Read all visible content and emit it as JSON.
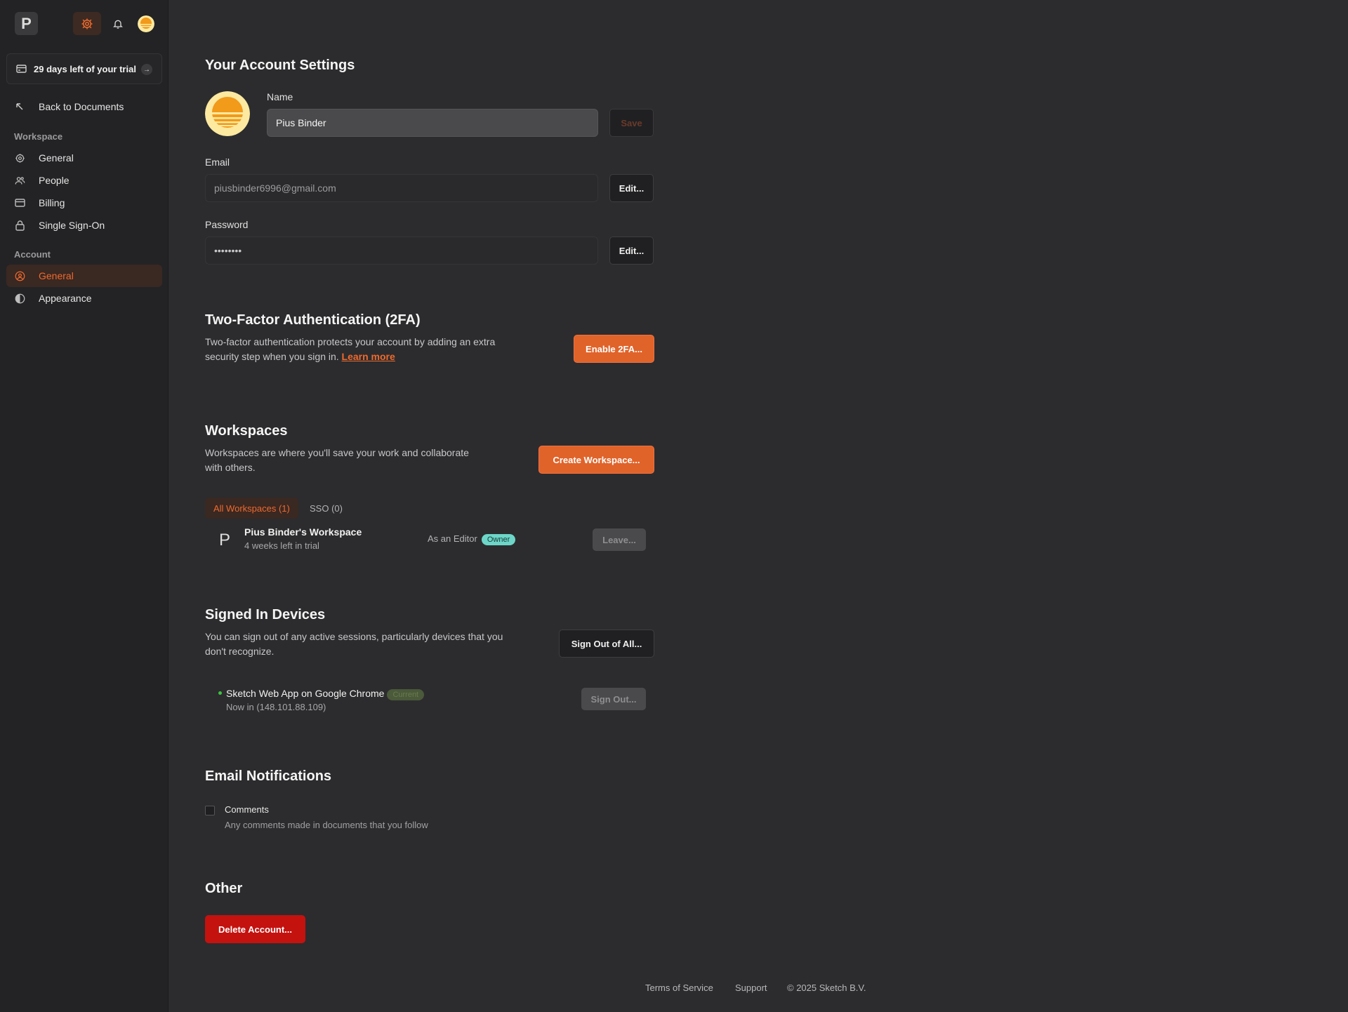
{
  "topbar": {
    "workspace_initial": "P",
    "icons": [
      "gear-icon",
      "bell-icon",
      "user-avatar"
    ],
    "accent": "#ee6a2e"
  },
  "trial": {
    "label": "29 days left of your trial"
  },
  "sidebar": {
    "back": "Back to Documents",
    "workspace_heading": "Workspace",
    "workspace_items": [
      {
        "label": "General",
        "icon": "gear-icon"
      },
      {
        "label": "People",
        "icon": "people-icon"
      },
      {
        "label": "Billing",
        "icon": "credit-card-icon"
      },
      {
        "label": "Single Sign-On",
        "icon": "lock-icon"
      }
    ],
    "account_heading": "Account",
    "account_items": [
      {
        "label": "General",
        "icon": "user-circle-icon",
        "selected": true
      },
      {
        "label": "Appearance",
        "icon": "contrast-icon"
      }
    ]
  },
  "account": {
    "title": "Your Account Settings",
    "name_label": "Name",
    "name_value": "Pius Binder",
    "save_label": "Save",
    "email_label": "Email",
    "email_value": "piusbinder6996@gmail.com",
    "email_edit": "Edit...",
    "password_label": "Password",
    "password_value": "••••••••",
    "password_edit": "Edit..."
  },
  "twofa": {
    "title": "Two-Factor Authentication (2FA)",
    "desc_line1": "Two-factor authentication protects your account by adding an extra",
    "desc_line2": "security step when you sign in.",
    "learn_more": "Learn more",
    "button": "Enable 2FA..."
  },
  "workspaces": {
    "title": "Workspaces",
    "desc_line1": "Workspaces are where you'll save your work and collaborate",
    "desc_line2": "with others.",
    "button": "Create Workspace...",
    "tabs": [
      {
        "label": "All Workspaces (1)",
        "active": true
      },
      {
        "label": "SSO (0)",
        "active": false
      }
    ],
    "items": [
      {
        "initial": "P",
        "name": "Pius Binder's Workspace",
        "sub": "4 weeks left in trial",
        "role": "As an Editor",
        "badge": "Owner",
        "action": "Leave..."
      }
    ]
  },
  "devices": {
    "title": "Signed In Devices",
    "desc_line1": "You can sign out of any active sessions, particularly devices that you",
    "desc_line2": "don't recognize.",
    "button": "Sign Out of All...",
    "items": [
      {
        "name": "Sketch Web App on Google Chrome",
        "badge": "Current",
        "sub": "Now in (148.101.88.109)",
        "action": "Sign Out..."
      }
    ]
  },
  "notifications": {
    "title": "Email Notifications",
    "items": [
      {
        "label": "Comments",
        "sub": "Any comments made in documents that you follow",
        "checked": false
      }
    ]
  },
  "other": {
    "title": "Other",
    "delete": "Delete Account..."
  },
  "footer": {
    "terms": "Terms of Service",
    "support": "Support",
    "copyright": "© 2025 Sketch B.V."
  }
}
